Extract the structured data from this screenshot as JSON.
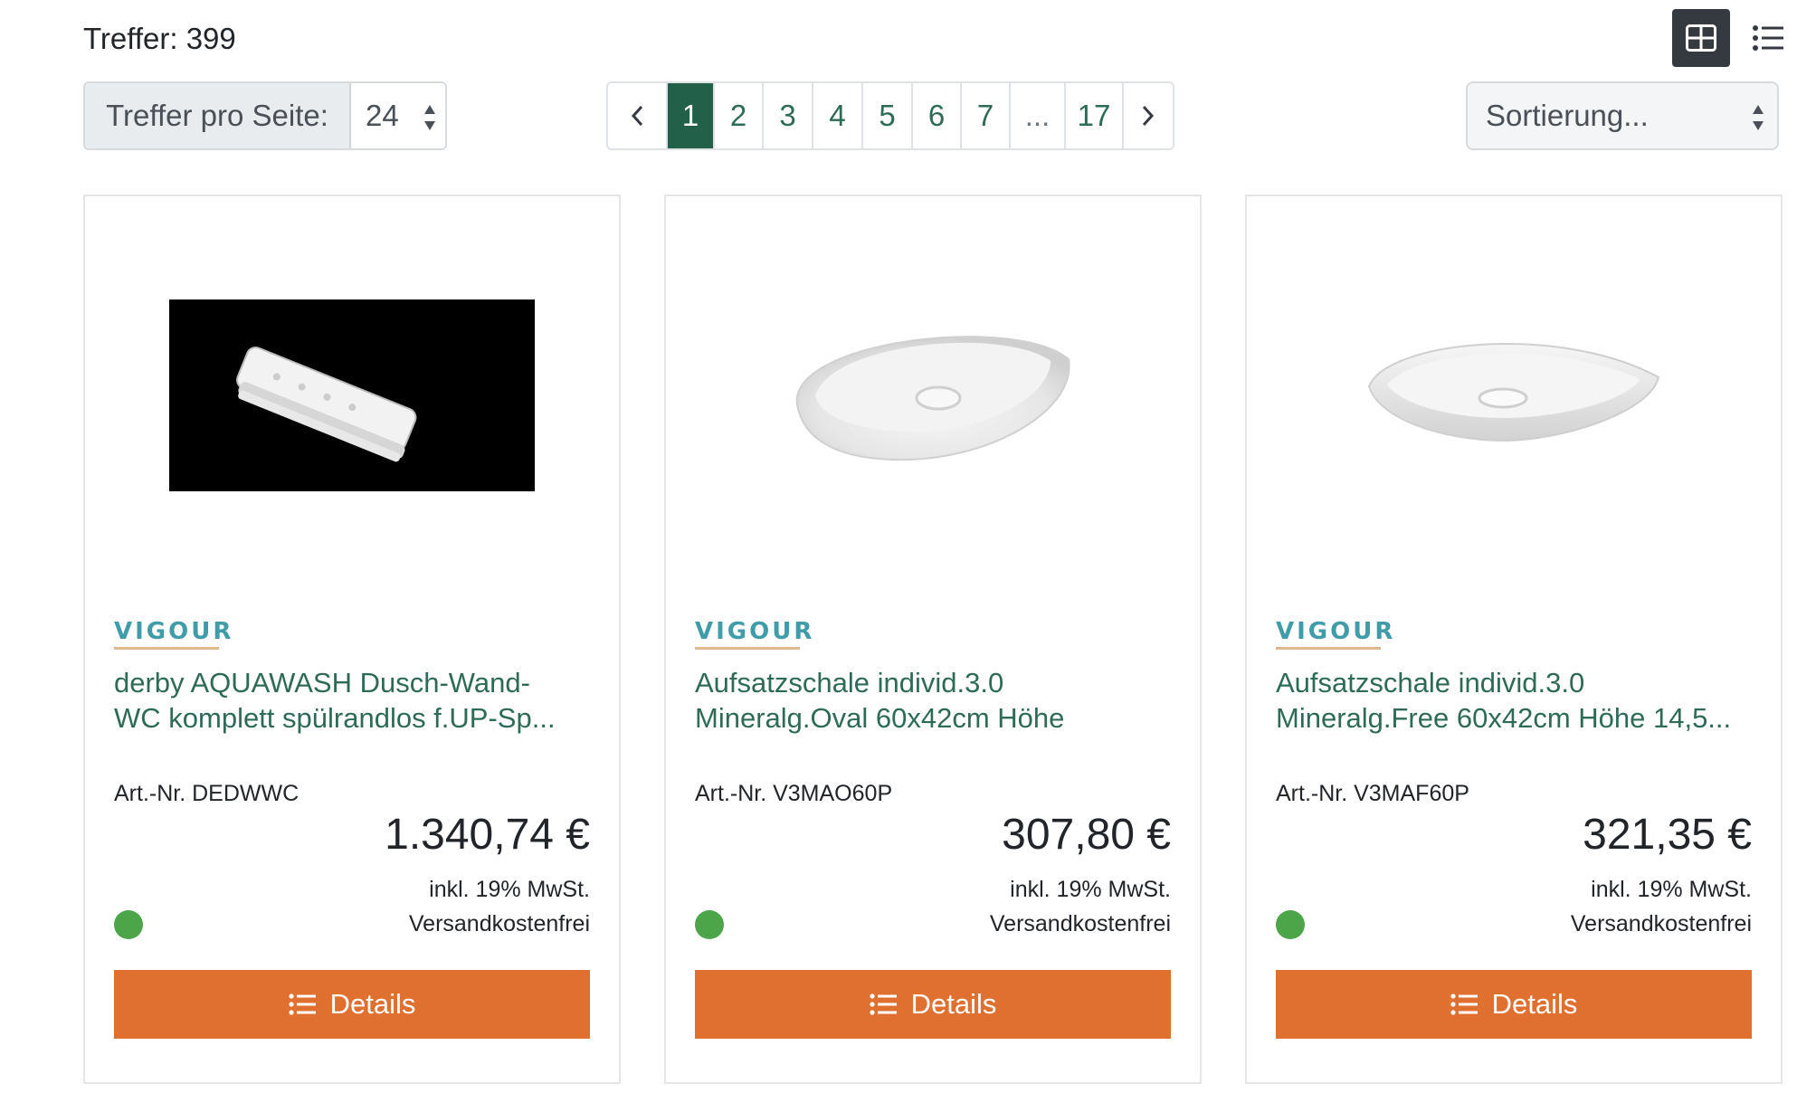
{
  "results": {
    "label": "Treffer: 399"
  },
  "view": {
    "grid_icon": "grid-view-icon",
    "list_icon": "list-view-icon",
    "active": "grid"
  },
  "per_page": {
    "label": "Treffer pro Seite:",
    "value": "24"
  },
  "pagination": {
    "prev_icon": "chevron-left-icon",
    "next_icon": "chevron-right-icon",
    "pages": [
      "1",
      "2",
      "3",
      "4",
      "5",
      "6",
      "7",
      "...",
      "17"
    ],
    "current": "1"
  },
  "sort": {
    "placeholder": "Sortierung..."
  },
  "colors": {
    "accent_green": "#22604a",
    "link_green": "#2e6b57",
    "button_orange": "#e07030",
    "stock_green": "#4da54a",
    "brand_teal": "#3f9ca8"
  },
  "products": [
    {
      "brand": "VIGOUR",
      "title_line1": "derby AQUAWASH Dusch-Wand-",
      "title_line2": "WC komplett spülrandlos f.UP-Sp...",
      "sku": "Art.-Nr. DEDWWC",
      "price": "1.340,74 €",
      "vat": "inkl. 19% MwSt.",
      "shipping": "Versandkostenfrei",
      "button": "Details",
      "image": "remote-control-on-black"
    },
    {
      "brand": "VIGOUR",
      "title_line1": "Aufsatzschale individ.3.0",
      "title_line2": "Mineralg.Oval 60x42cm Höhe",
      "sku": "Art.-Nr. V3MAO60P",
      "price": "307,80 €",
      "vat": "inkl. 19% MwSt.",
      "shipping": "Versandkostenfrei",
      "button": "Details",
      "image": "oval-washbasin"
    },
    {
      "brand": "VIGOUR",
      "title_line1": "Aufsatzschale individ.3.0",
      "title_line2": "Mineralg.Free 60x42cm Höhe 14,5...",
      "sku": "Art.-Nr. V3MAF60P",
      "price": "321,35 €",
      "vat": "inkl. 19% MwSt.",
      "shipping": "Versandkostenfrei",
      "button": "Details",
      "image": "freeform-washbasin"
    }
  ]
}
